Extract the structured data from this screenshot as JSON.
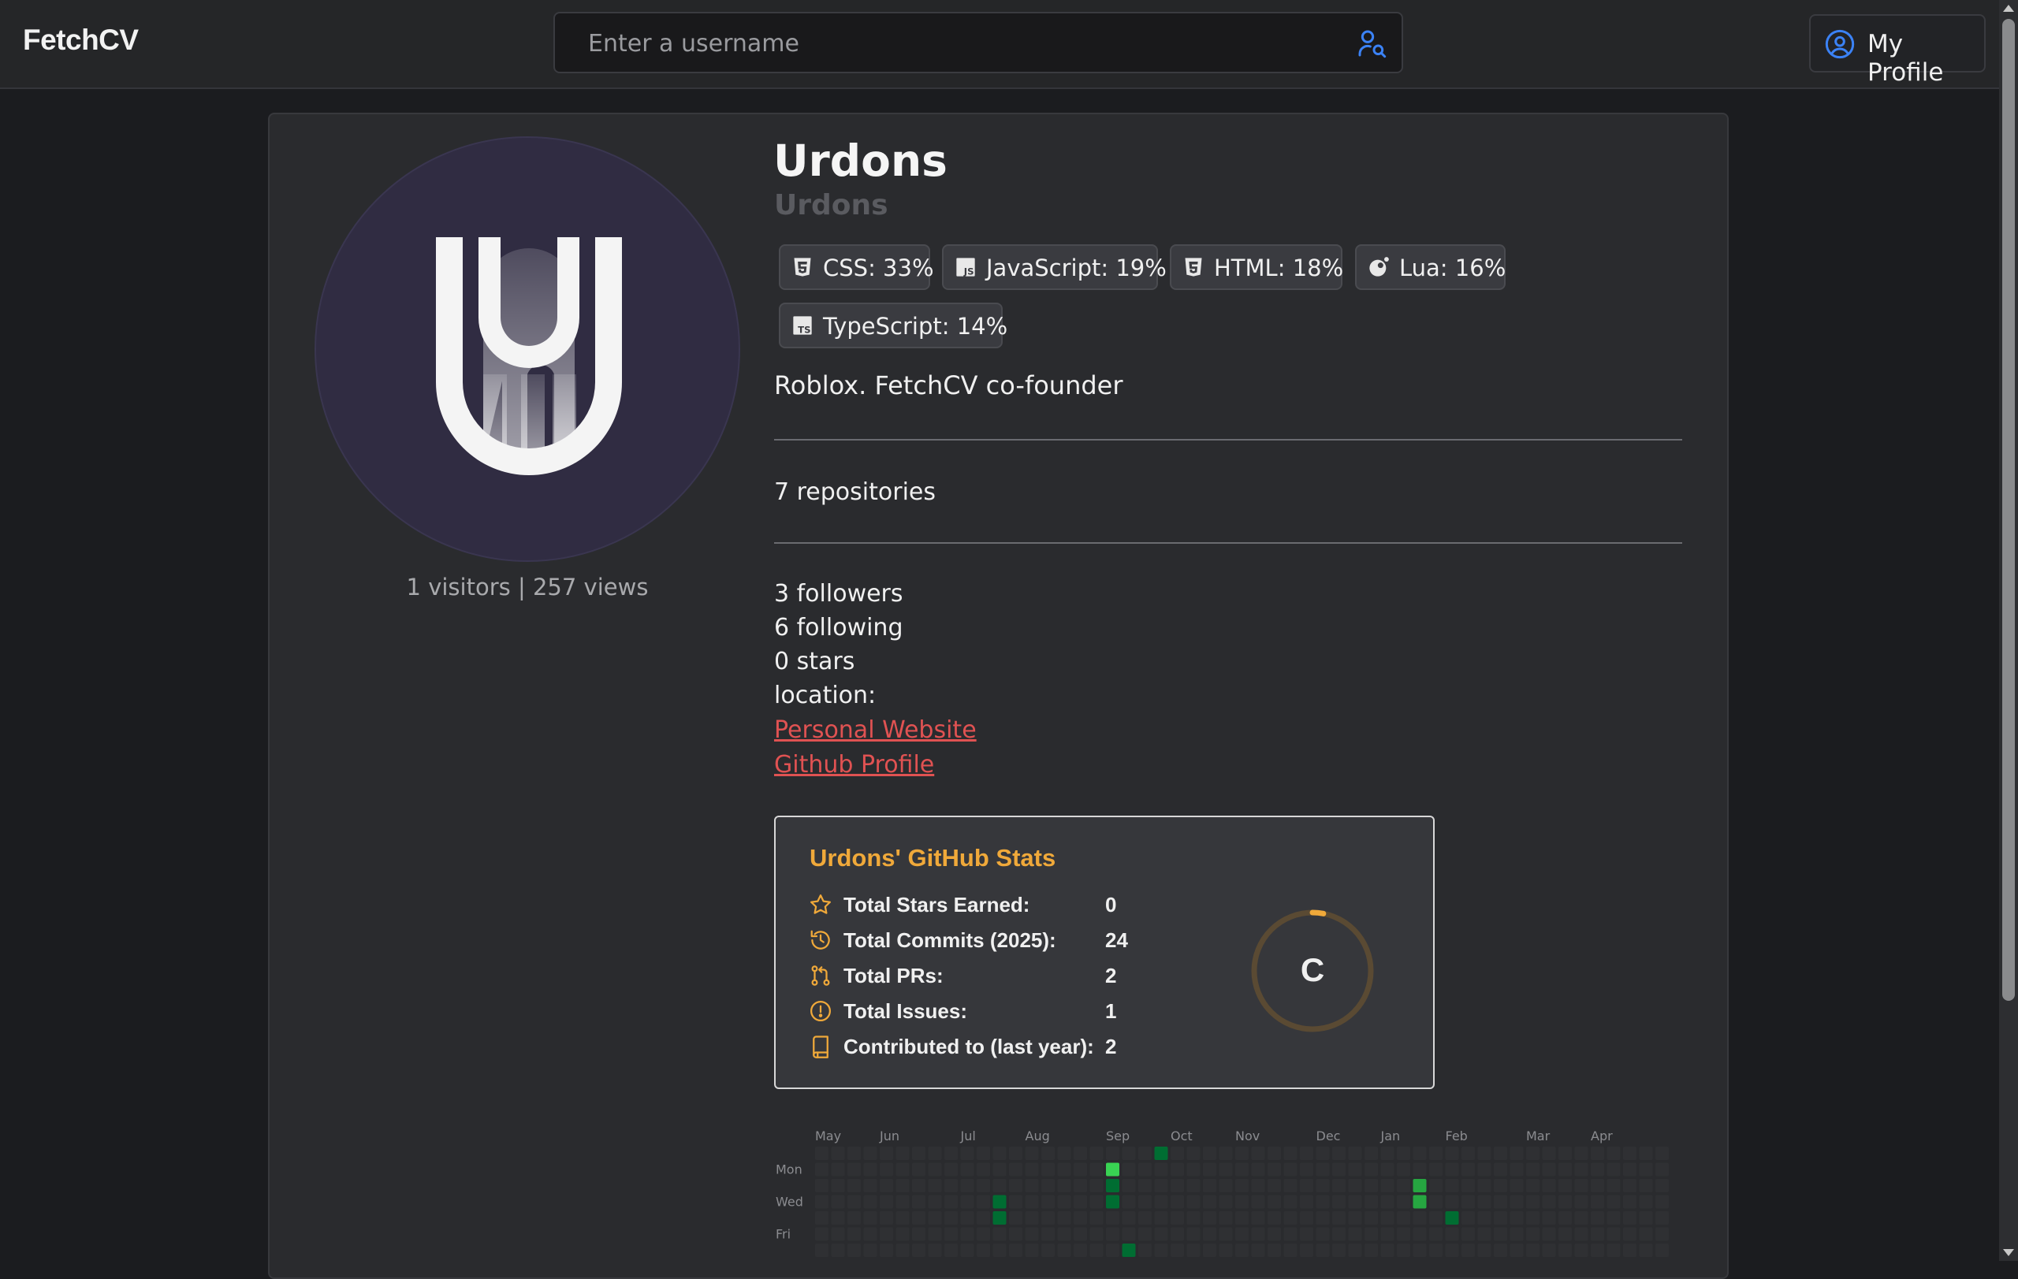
{
  "app": {
    "brand": "FetchCV"
  },
  "search": {
    "placeholder": "Enter a username",
    "icon": "user-search-icon"
  },
  "header": {
    "my_profile_label": "My Profile",
    "my_profile_icon": "user-circle-icon"
  },
  "colors": {
    "accent": "#f0a93a",
    "link": "#e05252",
    "icon_blue": "#3b82f6",
    "contrib_low": "#0e4429",
    "contrib_mid": "#006d32",
    "contrib_high": "#26a641",
    "contrib_max": "#39d353"
  },
  "profile": {
    "name": "Urdons",
    "login": "Urdons",
    "visitors_text": "1 visitors",
    "views_text": "257 views",
    "separator": "|",
    "bio": "Roblox. FetchCV co-founder",
    "repositories": "7 repositories",
    "followers": "3 followers",
    "following": "6 following",
    "stars": "0 stars",
    "location": "location:",
    "links": {
      "website": "Personal Website",
      "github": "Github Profile"
    }
  },
  "languages": [
    {
      "label": "CSS: 33%",
      "icon": "css3-icon"
    },
    {
      "label": "JavaScript: 19%",
      "icon": "javascript-icon"
    },
    {
      "label": "HTML: 18%",
      "icon": "html5-icon"
    },
    {
      "label": "Lua: 16%",
      "icon": "lua-icon"
    },
    {
      "label": "TypeScript: 14%",
      "icon": "typescript-icon"
    }
  ],
  "github_stats": {
    "title": "Urdons' GitHub Stats",
    "rows": [
      {
        "label": "Total Stars Earned:",
        "value": "0",
        "icon": "star-icon"
      },
      {
        "label": "Total Commits (2025):",
        "value": "24",
        "icon": "history-icon"
      },
      {
        "label": "Total PRs:",
        "value": "2",
        "icon": "pull-request-icon"
      },
      {
        "label": "Total Issues:",
        "value": "1",
        "icon": "issue-icon"
      },
      {
        "label": "Contributed to (last year):",
        "value": "2",
        "icon": "repo-icon"
      }
    ],
    "rank": "C",
    "rank_progress": 0.03
  },
  "contributions": {
    "months": [
      "May",
      "Jun",
      "Jul",
      "Aug",
      "Sep",
      "Oct",
      "Nov",
      "Dec",
      "Jan",
      "Feb",
      "Mar",
      "Apr"
    ],
    "day_labels": [
      "Mon",
      "Wed",
      "Fri"
    ],
    "weeks": 53,
    "active_days": [
      {
        "week": 18,
        "day": 1,
        "level": 4
      },
      {
        "week": 18,
        "day": 2,
        "level": 2
      },
      {
        "week": 18,
        "day": 3,
        "level": 2
      },
      {
        "week": 21,
        "day": 0,
        "level": 2
      },
      {
        "week": 11,
        "day": 3,
        "level": 2
      },
      {
        "week": 11,
        "day": 4,
        "level": 2
      },
      {
        "week": 19,
        "day": 6,
        "level": 2
      },
      {
        "week": 37,
        "day": 2,
        "level": 3
      },
      {
        "week": 37,
        "day": 3,
        "level": 3
      },
      {
        "week": 39,
        "day": 4,
        "level": 2
      }
    ]
  }
}
